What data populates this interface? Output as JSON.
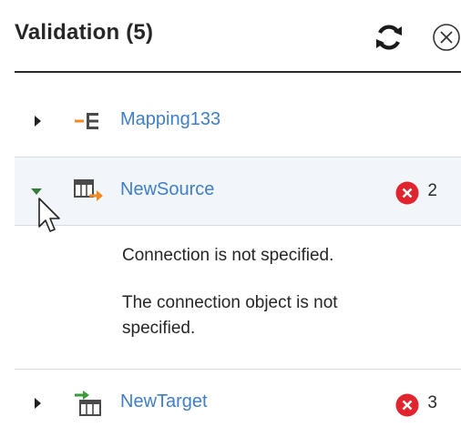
{
  "panel": {
    "title": "Validation (5)"
  },
  "items": [
    {
      "label": "Mapping133",
      "icon": "mapping-icon",
      "expanded": false
    },
    {
      "label": "NewSource",
      "icon": "source-icon",
      "expanded": true,
      "error_count": "2"
    },
    {
      "label": "NewTarget",
      "icon": "target-icon",
      "expanded": false,
      "error_count": "3"
    }
  ],
  "messages": [
    "Connection is not specified.",
    "The connection object is not specified."
  ],
  "colors": {
    "link": "#3f7ec8",
    "error": "#e0252e",
    "expanded_bg": "#f2f6fa",
    "divider": "#d4dbe1",
    "source_accent": "#f08a24",
    "target_accent": "#3c9a3c"
  }
}
